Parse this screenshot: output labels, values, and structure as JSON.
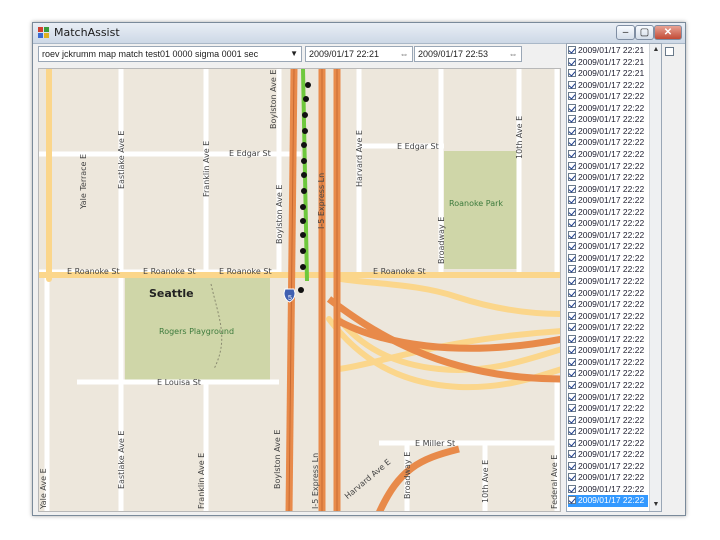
{
  "window": {
    "title": "MatchAssist"
  },
  "controls": {
    "minimize": "–",
    "maximize": "▢",
    "close": "✕"
  },
  "toolbar": {
    "combo_value": "roev jckrumm map match test01 0000 sigma 0001 sec",
    "start_date": "2009/01/17 22:21",
    "end_date": "2009/01/17 22:53"
  },
  "map": {
    "labels": {
      "seattle": "Seattle",
      "rogers_playground": "Rogers Playground",
      "roanoke_park": "Roanoke Park",
      "e_edgar_st": "E Edgar St",
      "e_edgar_st_2": "E Edgar St",
      "e_roanoke_st_1": "E Roanoke St",
      "e_roanoke_st_2": "E Roanoke St",
      "e_roanoke_st_3": "E Roanoke St",
      "e_roanoke_st_4": "E Roanoke St",
      "e_louisa_st": "E Louisa St",
      "e_miller_st": "E Miller St",
      "yale_terrace_e": "Yale Terrace E",
      "eastlake_ave_e_top": "Eastlake Ave E",
      "franklin_ave_e_top": "Franklin Ave E",
      "boylston_ave_e_top": "Boylston Ave E",
      "boylston_ave_e_mid": "Boylston Ave E",
      "boylston_ave_e_bottom": "Boylston Ave E",
      "i5_express_top": "I-5 Express Ln",
      "i5_express_bottom": "I-5 Express Ln",
      "harvard_ave_e": "Harvard Ave E",
      "broadway_e_top": "Broadway E",
      "broadway_e_bottom": "Broadway E",
      "tenth_ave_e_top": "10th Ave E",
      "tenth_ave_e_bottom": "10th Ave E",
      "yale_ave_e": "Yale Ave E",
      "eastlake_ave_e_bottom": "Eastlake Ave E",
      "franklin_ave_e_bottom": "Franklin Ave E",
      "harvard_ave_e_bottom": "Harvard Ave E",
      "federal_ave_e": "Federal Ave E",
      "highway_shield": "5"
    }
  },
  "timestamps": [
    "2009/01/17 22:21",
    "2009/01/17 22:21",
    "2009/01/17 22:21",
    "2009/01/17 22:22",
    "2009/01/17 22:22",
    "2009/01/17 22:22",
    "2009/01/17 22:22",
    "2009/01/17 22:22",
    "2009/01/17 22:22",
    "2009/01/17 22:22",
    "2009/01/17 22:22",
    "2009/01/17 22:22",
    "2009/01/17 22:22",
    "2009/01/17 22:22",
    "2009/01/17 22:22",
    "2009/01/17 22:22",
    "2009/01/17 22:22",
    "2009/01/17 22:22",
    "2009/01/17 22:22",
    "2009/01/17 22:22",
    "2009/01/17 22:22",
    "2009/01/17 22:22",
    "2009/01/17 22:22",
    "2009/01/17 22:22",
    "2009/01/17 22:22",
    "2009/01/17 22:22",
    "2009/01/17 22:22",
    "2009/01/17 22:22",
    "2009/01/17 22:22",
    "2009/01/17 22:22",
    "2009/01/17 22:22",
    "2009/01/17 22:22",
    "2009/01/17 22:22",
    "2009/01/17 22:22",
    "2009/01/17 22:22",
    "2009/01/17 22:22",
    "2009/01/17 22:22",
    "2009/01/17 22:22",
    "2009/01/17 22:22",
    "2009/01/17 22:22"
  ],
  "selected_index": 39,
  "colors": {
    "freeway": "#e88a4a",
    "arterial": "#fbd68b",
    "park": "#cfd6a8",
    "track": "#6ec83c",
    "selection": "#3399ff"
  }
}
